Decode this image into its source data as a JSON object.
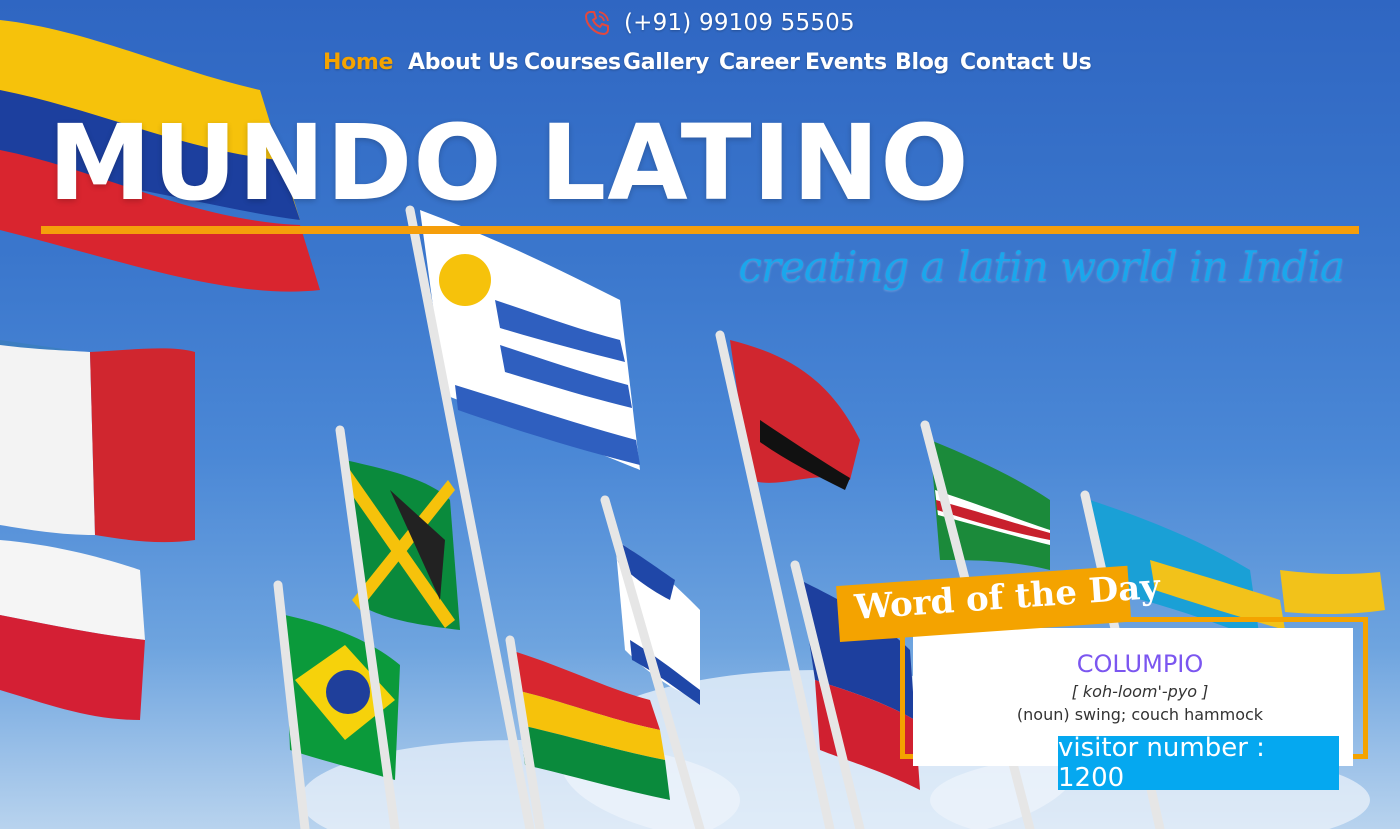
{
  "header": {
    "phone_icon": "phone-icon",
    "phone_number": "(+91) 99109 55505"
  },
  "nav": {
    "items": [
      "Home",
      "About Us",
      "Courses",
      "Gallery",
      "Career",
      "Events",
      "Blog",
      "Contact Us"
    ],
    "active": "Home"
  },
  "hero": {
    "brand": "MUNDO LATINO",
    "tagline": "creating a latin world in India"
  },
  "word_of_day": {
    "badge": "Word of the Day",
    "term": "COLUMPIO",
    "pronunciation": "[ koh-loom'-pyo ]",
    "definition": "(noun) swing; couch hammock"
  },
  "visitor": {
    "text": "visitor number : 1200"
  },
  "colors": {
    "accent": "#f4a300",
    "tagline": "#1aa7ec",
    "term": "#7b56f0",
    "visitor_bg": "#05a8f0"
  }
}
